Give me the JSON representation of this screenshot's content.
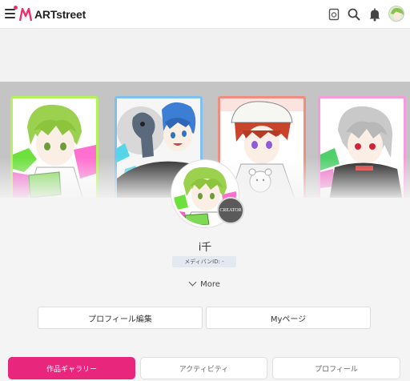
{
  "header": {
    "logo_text": "ARTstreet",
    "brand_color": "#e8336b",
    "icons": [
      "menu-icon",
      "tag-icon",
      "search-icon",
      "bell-icon",
      "user-avatar"
    ]
  },
  "profile": {
    "username": "i千",
    "media_id_label": "メディバンID: -",
    "badge_text": "CREATOR",
    "more_label": "More"
  },
  "actions": {
    "edit_profile": "プロフィール編集",
    "my_page": "Myページ"
  },
  "tabs": [
    {
      "label": "作品ギャラリー",
      "active": true
    },
    {
      "label": "アクティビティ",
      "active": false
    },
    {
      "label": "プロフィール",
      "active": false
    }
  ],
  "colors": {
    "accent": "#e8267c",
    "banner_bg": "#c4c4c4",
    "page_bg": "#f4f4f4"
  }
}
